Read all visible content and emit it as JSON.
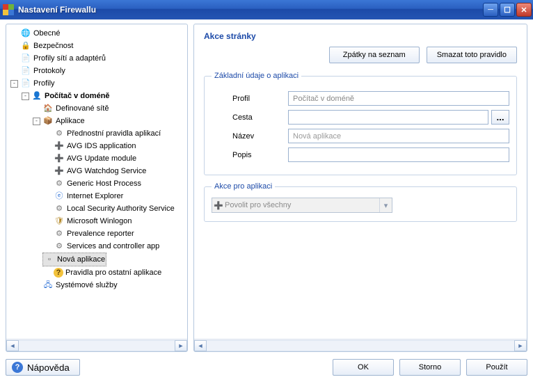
{
  "window": {
    "title": "Nastavení Firewallu"
  },
  "tree": {
    "obecne": "Obecné",
    "bezpecnost": "Bezpečnost",
    "profily_siti": "Profily sítí a adaptérů",
    "protokoly": "Protokoly",
    "profily": "Profily",
    "pocitac_v_domene": "Počítač v doméně",
    "definovane_site": "Definované sítě",
    "aplikace": "Aplikace",
    "apps": {
      "prednostni": "Přednostní pravidla aplikací",
      "ids": "AVG IDS application",
      "update": "AVG Update module",
      "watchdog": "AVG Watchdog Service",
      "generic": "Generic Host Process",
      "ie": "Internet Explorer",
      "lsas": "Local Security Authority Service",
      "winlogon": "Microsoft Winlogon",
      "prevalence": "Prevalence reporter",
      "services": "Services and controller app",
      "nova": "Nová aplikace",
      "ostatni": "Pravidla pro ostatní aplikace"
    },
    "systemove_sluzby": "Systémové služby"
  },
  "page": {
    "title": "Akce stránky",
    "back_btn": "Zpátky na seznam",
    "delete_btn": "Smazat toto pravidlo",
    "group1_legend": "Základní údaje o aplikaci",
    "profil_label": "Profil",
    "profil_value": "Počítač v doméně",
    "cesta_label": "Cesta",
    "cesta_value": "",
    "browse_label": "...",
    "nazev_label": "Název",
    "nazev_placeholder": "Nová aplikace",
    "nazev_value": "",
    "popis_label": "Popis",
    "popis_value": "",
    "group2_legend": "Akce pro aplikaci",
    "action_combo": "Povolit pro všechny"
  },
  "buttons": {
    "help": "Nápověda",
    "ok": "OK",
    "cancel": "Storno",
    "apply": "Použít"
  }
}
